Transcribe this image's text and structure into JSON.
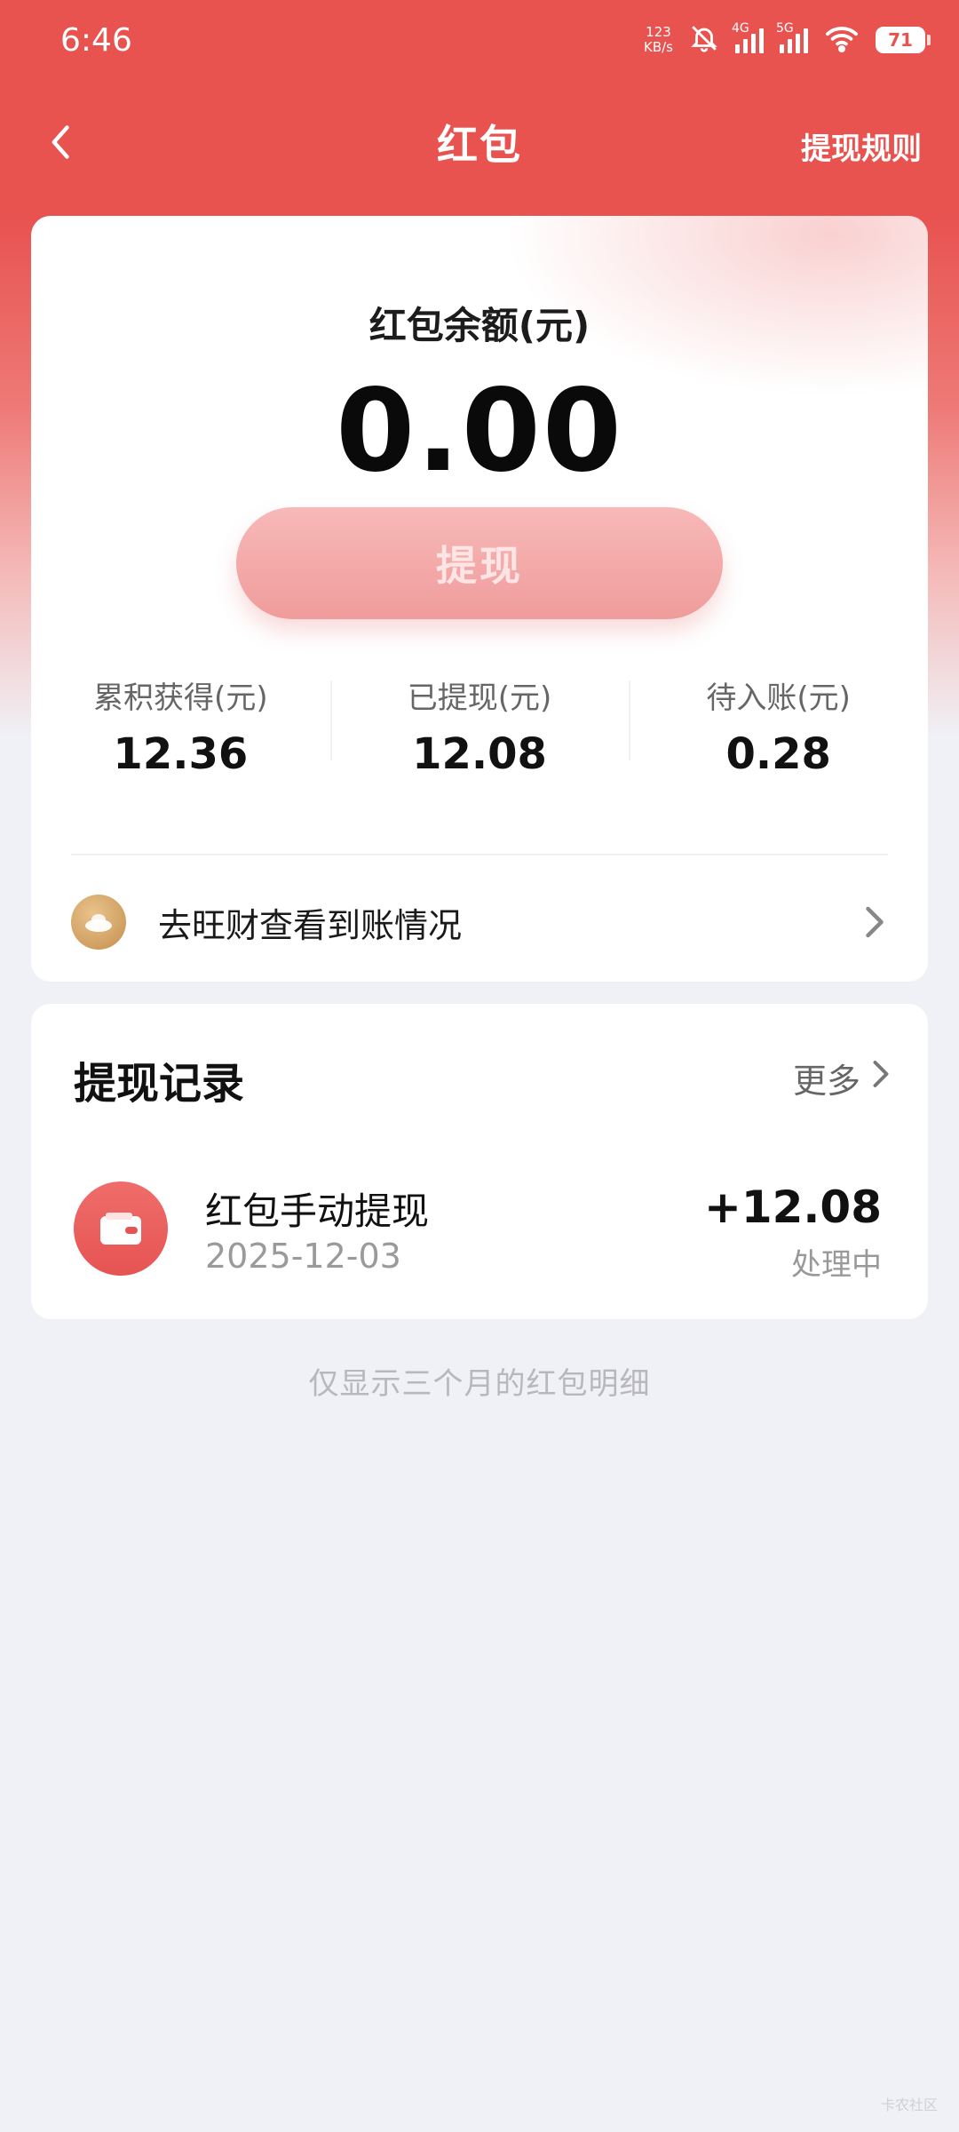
{
  "status_bar": {
    "time": "6:46",
    "speed_value": "123",
    "speed_unit": "KB/s",
    "net1": "4G",
    "net2": "5G",
    "battery": "71"
  },
  "nav": {
    "title": "红包",
    "rule_link": "提现规则"
  },
  "balance": {
    "label": "红包余额(元)",
    "value": "0.00",
    "withdraw_button": "提现",
    "stats": [
      {
        "label": "累积获得(元)",
        "value": "12.36"
      },
      {
        "label": "已提现(元)",
        "value": "12.08"
      },
      {
        "label": "待入账(元)",
        "value": "0.28"
      }
    ],
    "link_text": "去旺财查看到账情况"
  },
  "records": {
    "title": "提现记录",
    "more": "更多",
    "items": [
      {
        "name": "红包手动提现",
        "date": "2025-12-03",
        "amount": "+12.08",
        "status": "处理中"
      }
    ]
  },
  "footnote": "仅显示三个月的红包明细",
  "watermark": "卡农社区",
  "colors": {
    "brand_red": "#e8524f",
    "button_pink": "#f2a8a7"
  }
}
